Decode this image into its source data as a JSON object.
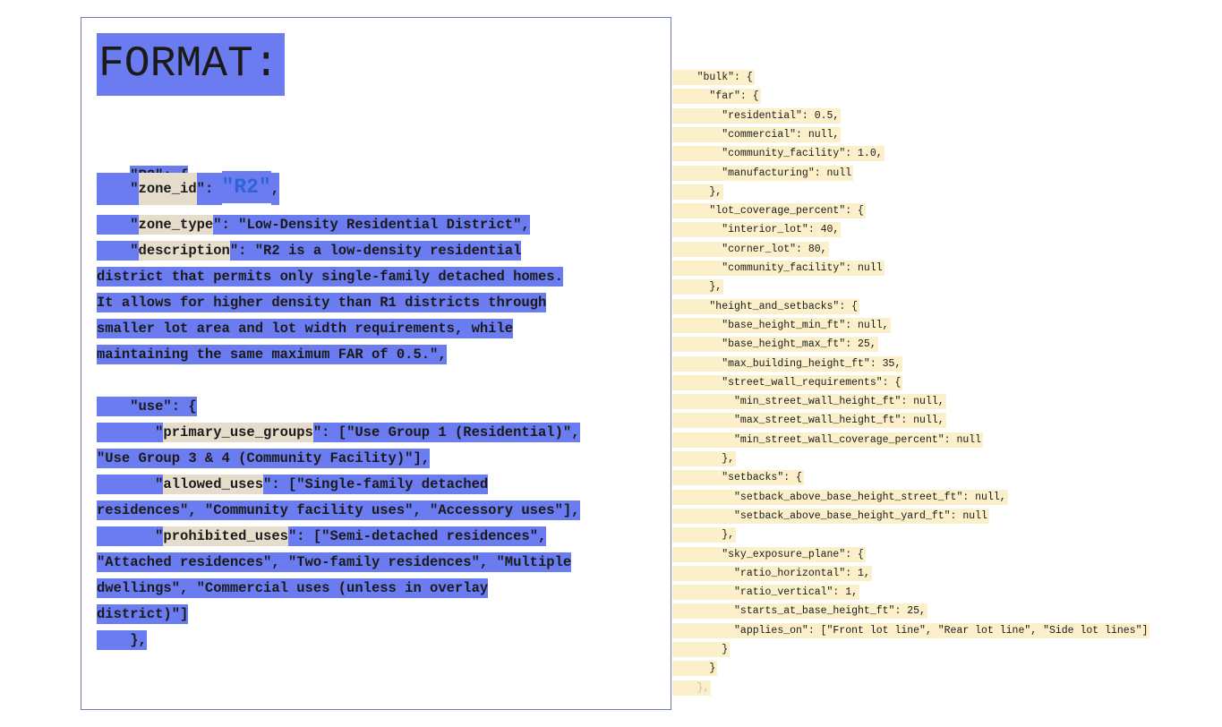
{
  "left": {
    "title": "FORMAT:",
    "line_r2_open": "\"R2\": {",
    "zone_id": {
      "indent": "    \"",
      "key": "zone_id",
      "mid": "\": ",
      "value": "\"R2\"",
      "tail": ","
    },
    "zone_type": {
      "indent": "    \"",
      "key": "zone_type",
      "rest": "\": \"Low-Density Residential District\","
    },
    "description": {
      "indent": "    \"",
      "key": "description",
      "rest": "\": \"R2 is a low-density residential"
    },
    "desc_lines": [
      "district that permits only single-family detached homes.",
      "It allows for higher density than R1 districts through",
      "smaller lot area and lot width requirements, while",
      "maintaining the same maximum FAR of 0.5.\","
    ],
    "use_open": "    \"use\": {",
    "primary": {
      "indent": "       \"",
      "key": "primary_use_groups",
      "rest": "\": [\"Use Group 1 (Residential)\","
    },
    "primary_cont": "\"Use Group 3 & 4 (Community Facility)\"],",
    "allowed": {
      "indent": "       \"",
      "key": "allowed_uses",
      "rest": "\": [\"Single-family detached"
    },
    "allowed_cont": "residences\", \"Community facility uses\", \"Accessory uses\"],",
    "prohibited": {
      "indent": "       \"",
      "key": "prohibited_uses",
      "rest": "\": [\"Semi-detached residences\","
    },
    "prohibited_cont": [
      "\"Attached residences\", \"Two-family residences\", \"Multiple",
      "dwellings\", \"Commercial uses (unless in overlay",
      "district)\"]"
    ],
    "use_close": "    },"
  },
  "right_lines": [
    "    \"bulk\": {",
    "      \"far\": {",
    "        \"residential\": 0.5,",
    "        \"commercial\": null,",
    "        \"community_facility\": 1.0,",
    "        \"manufacturing\": null",
    "      },",
    "      \"lot_coverage_percent\": {",
    "        \"interior_lot\": 40,",
    "        \"corner_lot\": 80,",
    "        \"community_facility\": null",
    "      },",
    "      \"height_and_setbacks\": {",
    "        \"base_height_min_ft\": null,",
    "        \"base_height_max_ft\": 25,",
    "        \"max_building_height_ft\": 35,",
    "        \"street_wall_requirements\": {",
    "          \"min_street_wall_height_ft\": null,",
    "          \"max_street_wall_height_ft\": null,",
    "          \"min_street_wall_coverage_percent\": null",
    "        },",
    "        \"setbacks\": {",
    "          \"setback_above_base_height_street_ft\": null,",
    "          \"setback_above_base_height_yard_ft\": null",
    "        },",
    "        \"sky_exposure_plane\": {",
    "          \"ratio_horizontal\": 1,",
    "          \"ratio_vertical\": 1,",
    "          \"starts_at_base_height_ft\": 25,",
    "          \"applies_on\": [\"Front lot line\", \"Rear lot line\", \"Side lot lines\"]",
    "        }",
    "      }",
    "    },"
  ],
  "colors": {
    "highlight_blue": "#6b7cf0",
    "key_tan": "#e6dccb",
    "right_highlight": "#fbf0c9",
    "value_blue": "#2f63d8"
  }
}
